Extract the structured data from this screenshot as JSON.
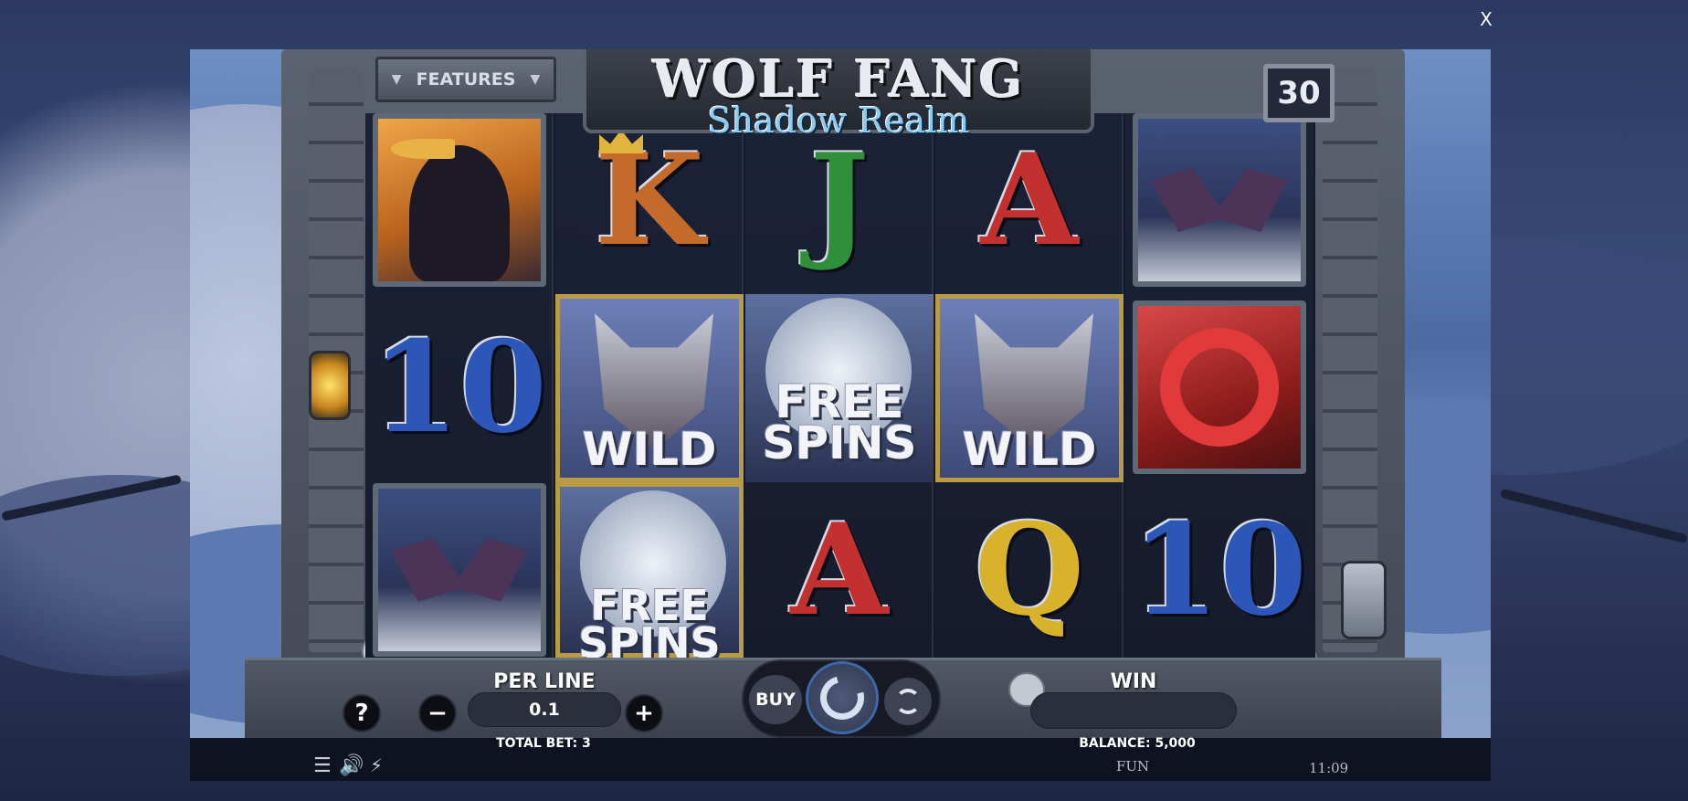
{
  "window": {
    "close_label": "X"
  },
  "game": {
    "title": "WOLF FANG",
    "subtitle": "Shadow Realm",
    "features_label": "FEATURES",
    "lines_count": "30"
  },
  "reels": [
    {
      "symbols": [
        {
          "kind": "raven-icon",
          "caption": ""
        },
        {
          "kind": "letter",
          "caption": "10",
          "color": "#2c56b8"
        },
        {
          "kind": "bat-icon",
          "caption": ""
        }
      ]
    },
    {
      "symbols": [
        {
          "kind": "letter",
          "caption": "K",
          "color": "#c46a2a"
        },
        {
          "kind": "wolf-icon",
          "caption": "WILD"
        },
        {
          "kind": "moon-icon",
          "caption": "FREE SPINS"
        }
      ]
    },
    {
      "symbols": [
        {
          "kind": "letter",
          "caption": "J",
          "color": "#2f8f3a"
        },
        {
          "kind": "moon-icon",
          "caption": "FREE SPINS"
        },
        {
          "kind": "letter",
          "caption": "A",
          "color": "#c23030"
        }
      ]
    },
    {
      "symbols": [
        {
          "kind": "letter",
          "caption": "A",
          "color": "#c23030"
        },
        {
          "kind": "wolf-icon",
          "caption": "WILD"
        },
        {
          "kind": "letter",
          "caption": "Q",
          "color": "#d8b22a"
        }
      ]
    },
    {
      "symbols": [
        {
          "kind": "bat-icon",
          "caption": ""
        },
        {
          "kind": "snake-icon",
          "caption": ""
        },
        {
          "kind": "letter",
          "caption": "10",
          "color": "#2c56b8"
        }
      ]
    }
  ],
  "controls": {
    "help_label": "?",
    "per_line_label": "PER LINE",
    "minus_label": "−",
    "plus_label": "+",
    "per_line_value": "0.1",
    "total_bet_label": "TOTAL BET: 3",
    "buy_label": "BUY",
    "win_label": "WIN",
    "win_value": "",
    "balance_label": "BALANCE: 5,000"
  },
  "status": {
    "mode": "FUN",
    "time": "11:09"
  },
  "colors": {
    "accent_blue": "#3f68a8",
    "gold": "#b99a45",
    "frame_stone": "#5c6370"
  }
}
